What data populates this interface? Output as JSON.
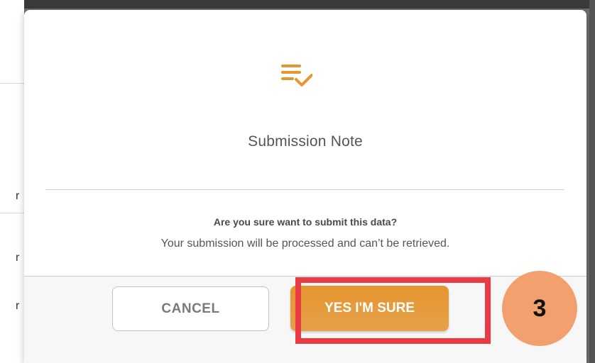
{
  "background": {
    "glyphs": [
      "r",
      "r",
      "r"
    ]
  },
  "modal": {
    "icon": "list-check-icon",
    "title": "Submission Note",
    "question": "Are you sure want to submit this data?",
    "detail": "Your submission will be processed and can’t be retrieved.",
    "cancel_label": "CANCEL",
    "confirm_label": "YES I'M SURE"
  },
  "annotation": {
    "step_number": "3"
  },
  "colors": {
    "accent": "#E6952F",
    "highlight": "#EA3B44",
    "badge": "#F1A06E"
  }
}
